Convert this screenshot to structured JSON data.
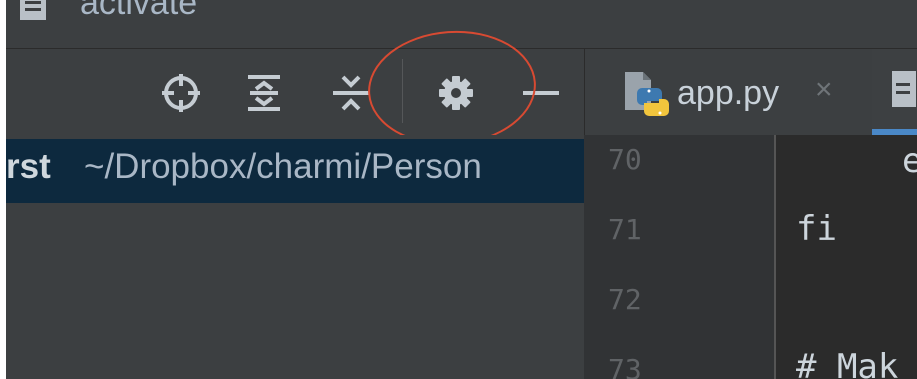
{
  "window": {
    "title": "activate"
  },
  "project_toolbar": {
    "icons": [
      "crosshair-icon",
      "expand-all-icon",
      "collapse-all-icon",
      "gear-icon",
      "minimize-icon"
    ]
  },
  "project_tree": {
    "selected_name": "rst",
    "selected_path": "~/Dropbox/charmi/Person"
  },
  "editor_tabs": [
    {
      "label": "app.py",
      "close": "×",
      "icon": "python-file-icon"
    },
    {
      "label": "",
      "icon": "text-file-icon"
    }
  ],
  "editor": {
    "lines": [
      {
        "number": "70",
        "code": "e"
      },
      {
        "number": "71",
        "code": "fi"
      },
      {
        "number": "72",
        "code": ""
      },
      {
        "number": "73",
        "code": "# Mak"
      }
    ]
  },
  "colors": {
    "panel": "#3c3f41",
    "selection": "#0d293e",
    "editor_bg": "#2b2b2b",
    "gutter_bg": "#313335",
    "annotation": "#d84a32",
    "tab_underline": "#4a88c7"
  }
}
